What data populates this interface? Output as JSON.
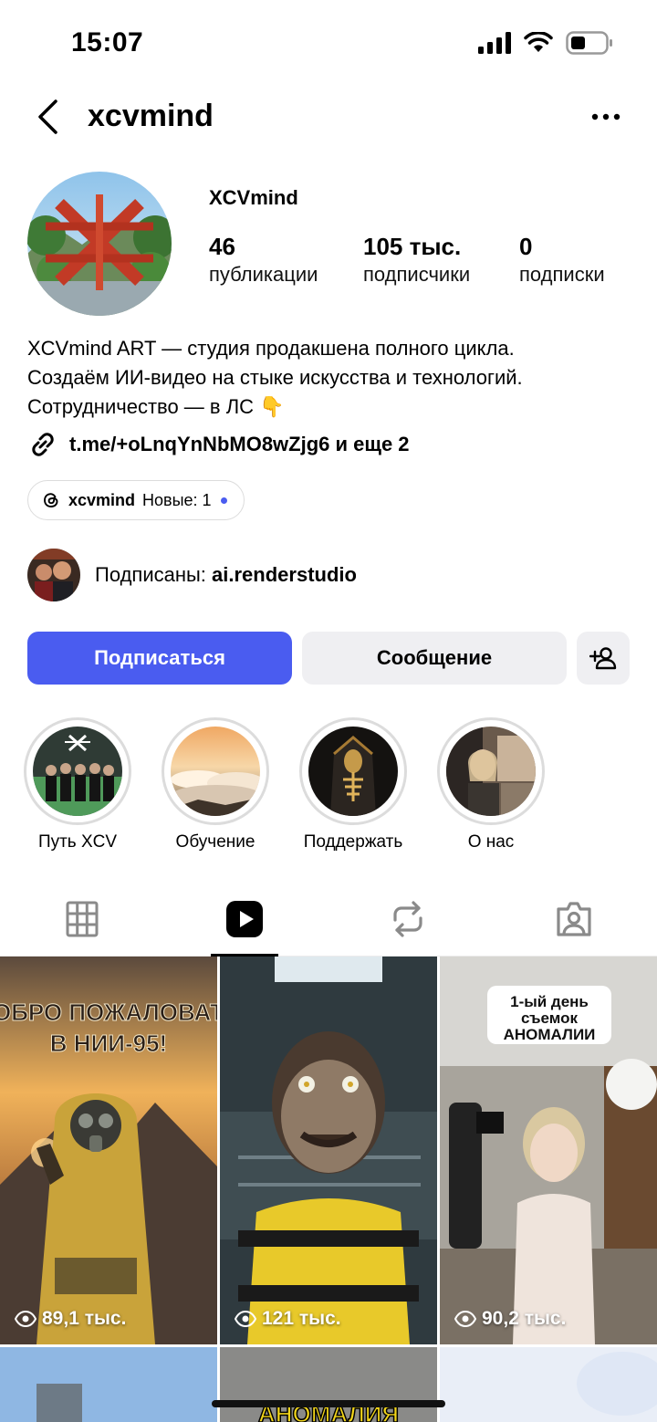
{
  "status_bar": {
    "time": "15:07"
  },
  "header": {
    "username": "xcvmind"
  },
  "profile": {
    "display_name": "XCVmind",
    "stats": [
      {
        "value": "46",
        "label": "публикации"
      },
      {
        "value": "105 тыс.",
        "label": "подписчики"
      },
      {
        "value": "0",
        "label": "подписки"
      }
    ],
    "bio_lines": [
      "XCVmind ART — студия продакшена полного цикла.",
      "Создаём ИИ-видео на стыке искусства и технологий.",
      "Сотрудничество — в ЛС 👇"
    ],
    "link_text": "t.me/+oLnqYnNbMO8wZjg6 и еще 2",
    "threads": {
      "name": "xcvmind",
      "new_label": "Новые: 1"
    },
    "followed_by": {
      "prefix": "Подписаны: ",
      "user": "ai.renderstudio"
    }
  },
  "buttons": {
    "follow": "Подписаться",
    "message": "Сообщение"
  },
  "highlights": [
    {
      "label": "Путь XCV"
    },
    {
      "label": "Обучение"
    },
    {
      "label": "Поддержать"
    },
    {
      "label": "О нас"
    }
  ],
  "grid": {
    "items": [
      {
        "views": "89,1 тыс.",
        "overlay_text": [
          "ДОБРО ПОЖАЛОВАТЬ",
          "В НИИ-95!"
        ]
      },
      {
        "views": "121 тыс."
      },
      {
        "views": "90,2 тыс.",
        "overlay_text": [
          "1-ый день",
          "съемок",
          "АНОМАЛИИ"
        ]
      }
    ],
    "bottom_partial_text": "АНОМАЛИЯ"
  },
  "colors": {
    "accent": "#4a5cf0",
    "secondary_button": "#efeff2"
  }
}
